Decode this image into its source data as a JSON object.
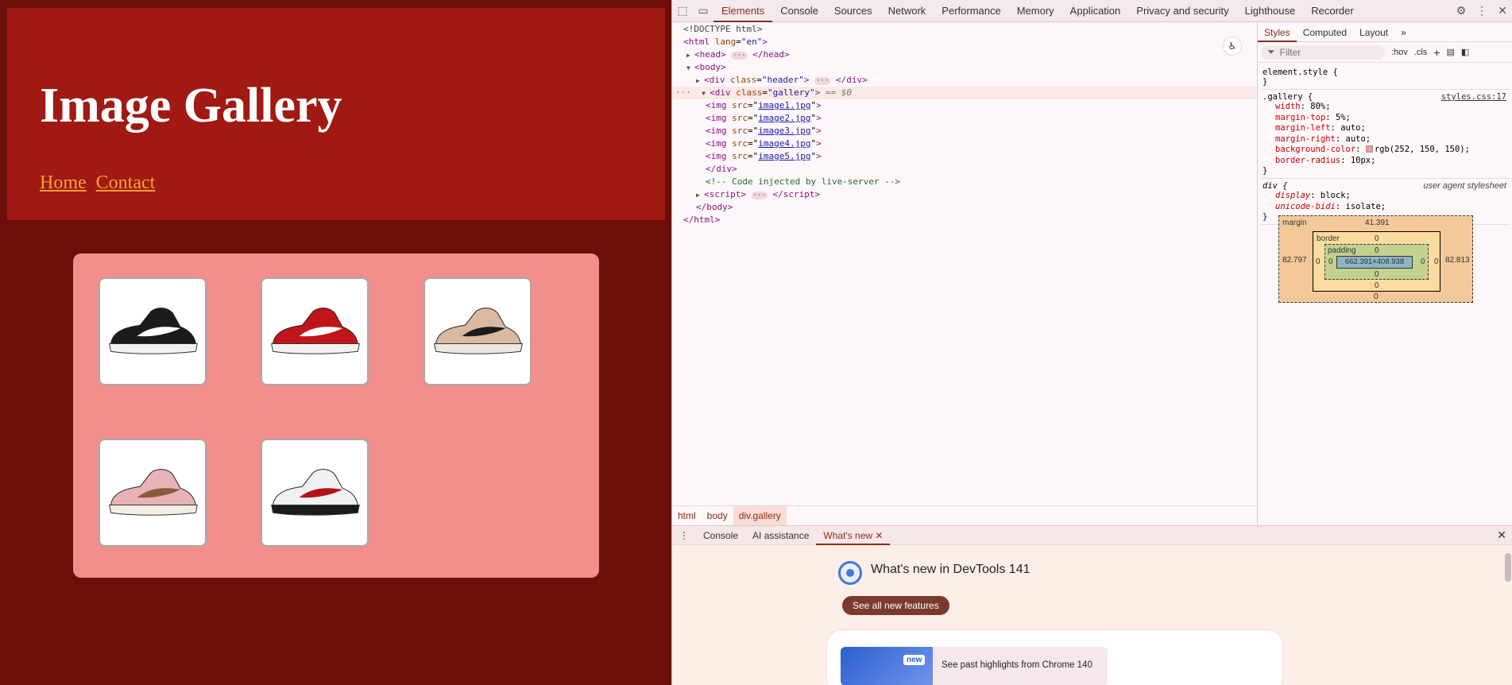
{
  "page": {
    "title": "Image Gallery",
    "nav": [
      "Home",
      "Contact"
    ],
    "images": [
      {
        "icon": "sneaker-black-white-icon",
        "colors": {
          "upper": "#1b1b1b",
          "accent": "#ffffff",
          "sole": "#f2f2f2"
        }
      },
      {
        "icon": "sneaker-red-black-icon",
        "colors": {
          "upper": "#c0161b",
          "accent": "#ffffff",
          "sole": "#f2f2f2"
        }
      },
      {
        "icon": "sneaker-tan-black-icon",
        "colors": {
          "upper": "#d9b9a0",
          "accent": "#1b1b1b",
          "sole": "#ece7df"
        }
      },
      {
        "icon": "sneaker-pink-icon",
        "colors": {
          "upper": "#e8b3b6",
          "accent": "#8a5a3b",
          "sole": "#f3ede4"
        }
      },
      {
        "icon": "sneaker-white-black-red-icon",
        "colors": {
          "upper": "#f1f1f1",
          "accent": "#b3141a",
          "sole": "#1a1a1a"
        }
      }
    ],
    "colors": {
      "background": "#6c0f0b",
      "header": "#a01913",
      "gallery": "#f28e8b",
      "link": "#f6a234"
    }
  },
  "devtools": {
    "tabs": [
      "Elements",
      "Console",
      "Sources",
      "Network",
      "Performance",
      "Memory",
      "Application",
      "Privacy and security",
      "Lighthouse",
      "Recorder"
    ],
    "active_tab": "Elements",
    "dom": {
      "doctype": "<!DOCTYPE html>",
      "html_open": "html",
      "lang_attr": "lang",
      "lang_val": "\"en\"",
      "head": "head",
      "body": "body",
      "div": "div",
      "class_attr": "class",
      "header_class": "\"header\"",
      "gallery_class": "\"gallery\"",
      "selected_marker": "== $0",
      "img": "img",
      "src_attr": "src",
      "images": [
        "image1.jpg",
        "image2.jpg",
        "image3.jpg",
        "image4.jpg",
        "image5.jpg"
      ],
      "comment": "<!-- Code injected by live-server -->",
      "script": "script"
    },
    "breadcrumbs": [
      "html",
      "body",
      "div.gallery"
    ],
    "styles_tabs": [
      "Styles",
      "Computed",
      "Layout"
    ],
    "filter_placeholder": "Filter",
    "filter_buttons": [
      ":hov",
      ".cls"
    ],
    "element_style": "element.style {",
    "gallery_rule": {
      "selector": ".gallery {",
      "source": "styles.css:17",
      "props": [
        {
          "name": "width",
          "value": "80%;"
        },
        {
          "name": "margin-top",
          "value": "5%;"
        },
        {
          "name": "margin-left",
          "value": "auto;"
        },
        {
          "name": "margin-right",
          "value": "auto;"
        },
        {
          "name": "background-color",
          "value": "rgb(252, 150, 150);",
          "swatch": "#fc9696"
        },
        {
          "name": "border-radius",
          "value": "10px;"
        }
      ]
    },
    "div_rule": {
      "selector": "div {",
      "source": "user agent stylesheet",
      "props": [
        {
          "name": "display",
          "value": "block;"
        },
        {
          "name": "unicode-bidi",
          "value": "isolate;"
        }
      ]
    },
    "box_model": {
      "margin_label": "margin",
      "margin_top": "41.391",
      "margin_left": "82.797",
      "margin_right": "82.813",
      "margin_bottom": "0",
      "border_label": "border",
      "border_top": "0",
      "border_left": "0",
      "border_right": "0",
      "border_bottom": "0",
      "padding_label": "padding",
      "padding_top": "0",
      "padding_left": "0",
      "padding_right": "0",
      "padding_bottom": "0",
      "content": "662.391×408.938"
    },
    "drawer": {
      "tabs": [
        "Console",
        "AI assistance",
        "What's new"
      ],
      "active_tab": "What's new",
      "title": "What's new in DevTools 141",
      "see_all": "See all new features",
      "new_badge": "new",
      "past_highlights": "See past highlights from Chrome 140"
    }
  }
}
